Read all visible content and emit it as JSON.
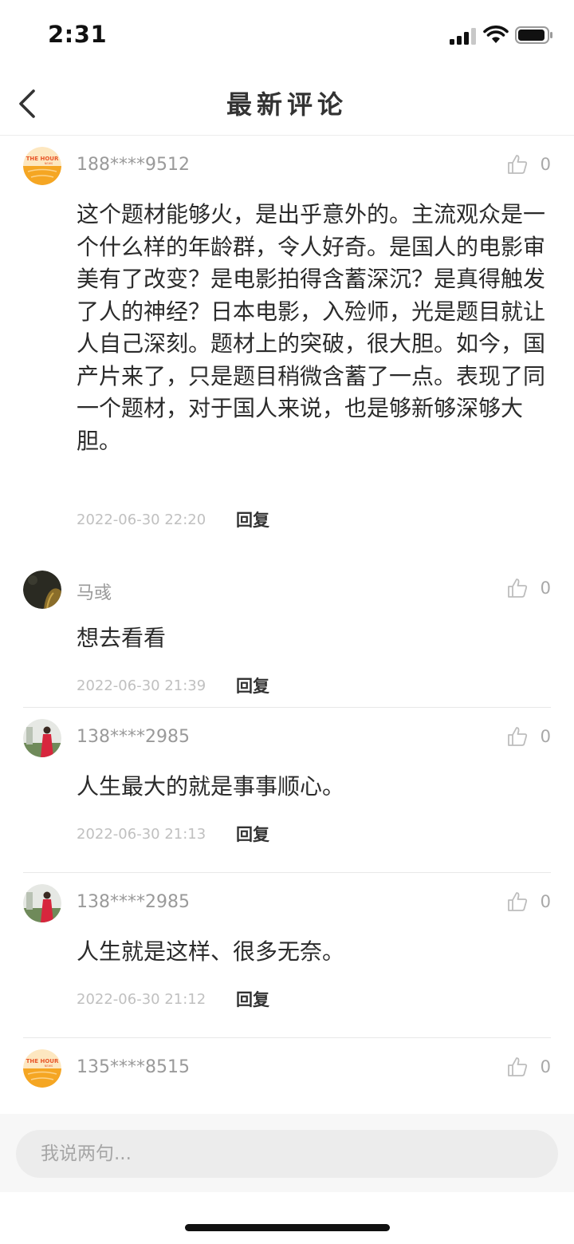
{
  "status_bar": {
    "time": "2:31"
  },
  "nav": {
    "title": "最新评论"
  },
  "comments": [
    {
      "avatar": "orange-logo",
      "logo_text": "THE HOUR",
      "logo_subtext": "NEWS",
      "user": "188****9512",
      "likes": "0",
      "text": "这个题材能够火，是出乎意外的。主流观众是一个什么样的年龄群，令人好奇。是国人的电影审美有了改变？是电影拍得含蓄深沉？是真得触发了人的神经？日本电影，入殓师，光是题目就让人自己深刻。题材上的突破，很大胆。如今，国产片来了，只是题目稍微含蓄了一点。表现了同一个题材，对于国人来说，也是够新够深够大胆。",
      "time": "2022-06-30 22:20",
      "reply": "回复"
    },
    {
      "avatar": "dark-photo",
      "user": "马彧",
      "likes": "0",
      "text": "想去看看",
      "time": "2022-06-30 21:39",
      "reply": "回复"
    },
    {
      "avatar": "person-red",
      "user": "138****2985",
      "likes": "0",
      "text": "人生最大的就是事事顺心。",
      "time": "2022-06-30 21:13",
      "reply": "回复"
    },
    {
      "avatar": "person-red",
      "user": "138****2985",
      "likes": "0",
      "text": "人生就是这样、很多无奈。",
      "time": "2022-06-30 21:12",
      "reply": "回复"
    },
    {
      "avatar": "orange-logo",
      "logo_text": "THE HOUR",
      "logo_subtext": "NEWS",
      "user": "135****8515",
      "likes": "0"
    }
  ],
  "input": {
    "placeholder": "我说两句..."
  },
  "colors": {
    "accent_orange": "#f5a623",
    "text_gray": "#9a9a9a",
    "timestamp_gray": "#c0c0c0"
  },
  "icons": {
    "back": "chevron-left-icon",
    "like": "thumbs-up-icon",
    "signal": "signal-icon",
    "wifi": "wifi-icon",
    "battery": "battery-icon"
  }
}
